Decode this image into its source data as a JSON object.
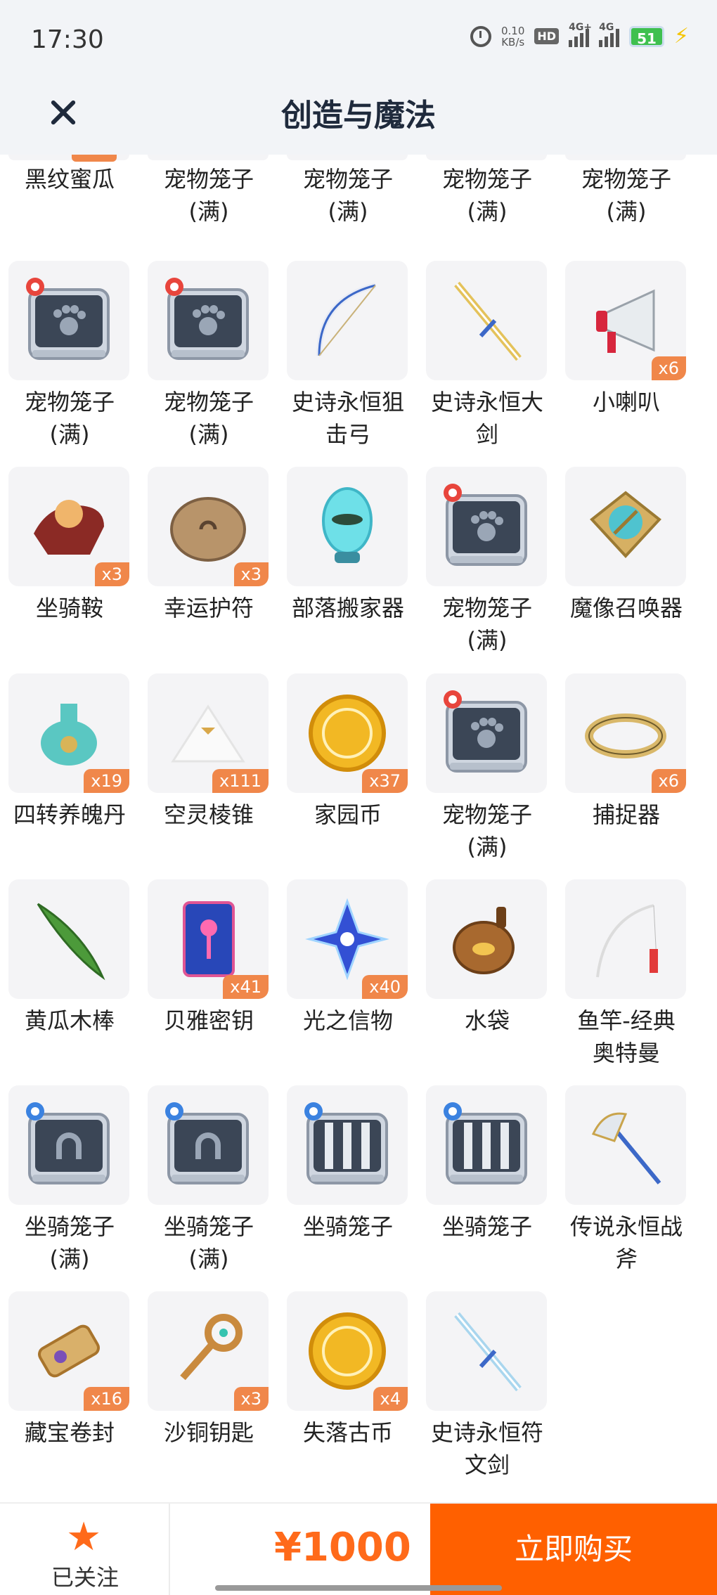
{
  "status_bar": {
    "time": "17:30",
    "net_speed_value": "0.10",
    "net_speed_unit": "KB/s",
    "hd_label": "HD",
    "signal_1": "4G+",
    "signal_2": "4G",
    "battery": "51"
  },
  "header": {
    "title": "创造与魔法",
    "close_icon": "close-icon"
  },
  "top_row_partial": [
    {
      "name": "黑纹蜜瓜"
    },
    {
      "name": "宠物笼子\n(满)"
    },
    {
      "name": "宠物笼子\n(满)"
    },
    {
      "name": "宠物笼子\n(满)"
    },
    {
      "name": "宠物笼子\n(满)"
    }
  ],
  "items": [
    {
      "name": "宠物笼子\n(满)",
      "qty": "",
      "icon": "pet-cage-icon"
    },
    {
      "name": "宠物笼子\n(满)",
      "qty": "",
      "icon": "pet-cage-icon"
    },
    {
      "name": "史诗永恒狙\n击弓",
      "qty": "",
      "icon": "bow-icon"
    },
    {
      "name": "史诗永恒大\n剑",
      "qty": "",
      "icon": "greatsword-icon"
    },
    {
      "name": "小喇叭",
      "qty": "x6",
      "icon": "megaphone-icon"
    },
    {
      "name": "坐骑鞍",
      "qty": "x3",
      "icon": "saddle-icon"
    },
    {
      "name": "幸运护符",
      "qty": "x3",
      "icon": "lucky-charm-icon"
    },
    {
      "name": "部落搬家器",
      "qty": "",
      "icon": "tribe-mover-icon"
    },
    {
      "name": "宠物笼子\n(满)",
      "qty": "",
      "icon": "pet-cage-icon"
    },
    {
      "name": "魔像召唤器",
      "qty": "",
      "icon": "golem-summoner-icon"
    },
    {
      "name": "四转养魄丹",
      "qty": "x19",
      "icon": "potion-icon"
    },
    {
      "name": "空灵棱锥",
      "qty": "x111",
      "icon": "pyramid-icon"
    },
    {
      "name": "家园币",
      "qty": "x37",
      "icon": "home-coin-icon"
    },
    {
      "name": "宠物笼子\n(满)",
      "qty": "",
      "icon": "pet-cage-icon"
    },
    {
      "name": "捕捉器",
      "qty": "x6",
      "icon": "catcher-icon"
    },
    {
      "name": "黄瓜木棒",
      "qty": "",
      "icon": "cucumber-icon"
    },
    {
      "name": "贝雅密钥",
      "qty": "x41",
      "icon": "key-card-icon"
    },
    {
      "name": "光之信物",
      "qty": "x40",
      "icon": "light-token-icon"
    },
    {
      "name": "水袋",
      "qty": "",
      "icon": "water-bag-icon"
    },
    {
      "name": "鱼竿-经典\n奥特曼",
      "qty": "",
      "icon": "fishing-rod-icon"
    },
    {
      "name": "坐骑笼子\n(满)",
      "qty": "",
      "icon": "mount-cage-full-icon"
    },
    {
      "name": "坐骑笼子\n(满)",
      "qty": "",
      "icon": "mount-cage-full-icon"
    },
    {
      "name": "坐骑笼子",
      "qty": "",
      "icon": "mount-cage-icon"
    },
    {
      "name": "坐骑笼子",
      "qty": "",
      "icon": "mount-cage-icon"
    },
    {
      "name": "传说永恒战\n斧",
      "qty": "",
      "icon": "battle-axe-icon"
    },
    {
      "name": "藏宝卷封",
      "qty": "x16",
      "icon": "treasure-scroll-icon"
    },
    {
      "name": "沙铜钥匙",
      "qty": "x3",
      "icon": "bronze-key-icon"
    },
    {
      "name": "失落古币",
      "qty": "x4",
      "icon": "ancient-coin-icon"
    },
    {
      "name": "史诗永恒符\n文剑",
      "qty": "",
      "icon": "rune-sword-icon"
    }
  ],
  "bottom_bar": {
    "follow_label": "已关注",
    "price": "¥1000",
    "buy_label": "立即购买"
  },
  "colors": {
    "accent": "#ff6000",
    "badge": "#f0874a",
    "card_bg": "#f4f4f6",
    "header_bg": "#f2f4f7"
  }
}
